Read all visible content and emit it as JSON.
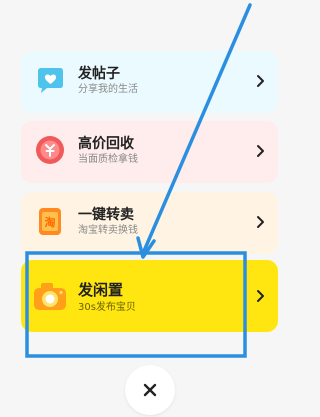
{
  "menu": {
    "items": [
      {
        "title": "发帖子",
        "subtitle": "分享我的生活",
        "icon": "heart-chat-icon",
        "bg": "#eafaff"
      },
      {
        "title": "高价回收",
        "subtitle": "当面质检拿钱",
        "icon": "recycle-coin-icon",
        "bg": "#ffecec"
      },
      {
        "title": "一键转卖",
        "subtitle": "淘宝转卖换钱",
        "icon": "taobao-bag-icon",
        "bg": "#fff4e3"
      },
      {
        "title": "发闲置",
        "subtitle": "30s发布宝贝",
        "icon": "camera-icon",
        "bg": "#ffe611"
      }
    ]
  },
  "close": {
    "icon": "close-icon"
  },
  "annotation": {
    "color": "#2a8fe0"
  }
}
